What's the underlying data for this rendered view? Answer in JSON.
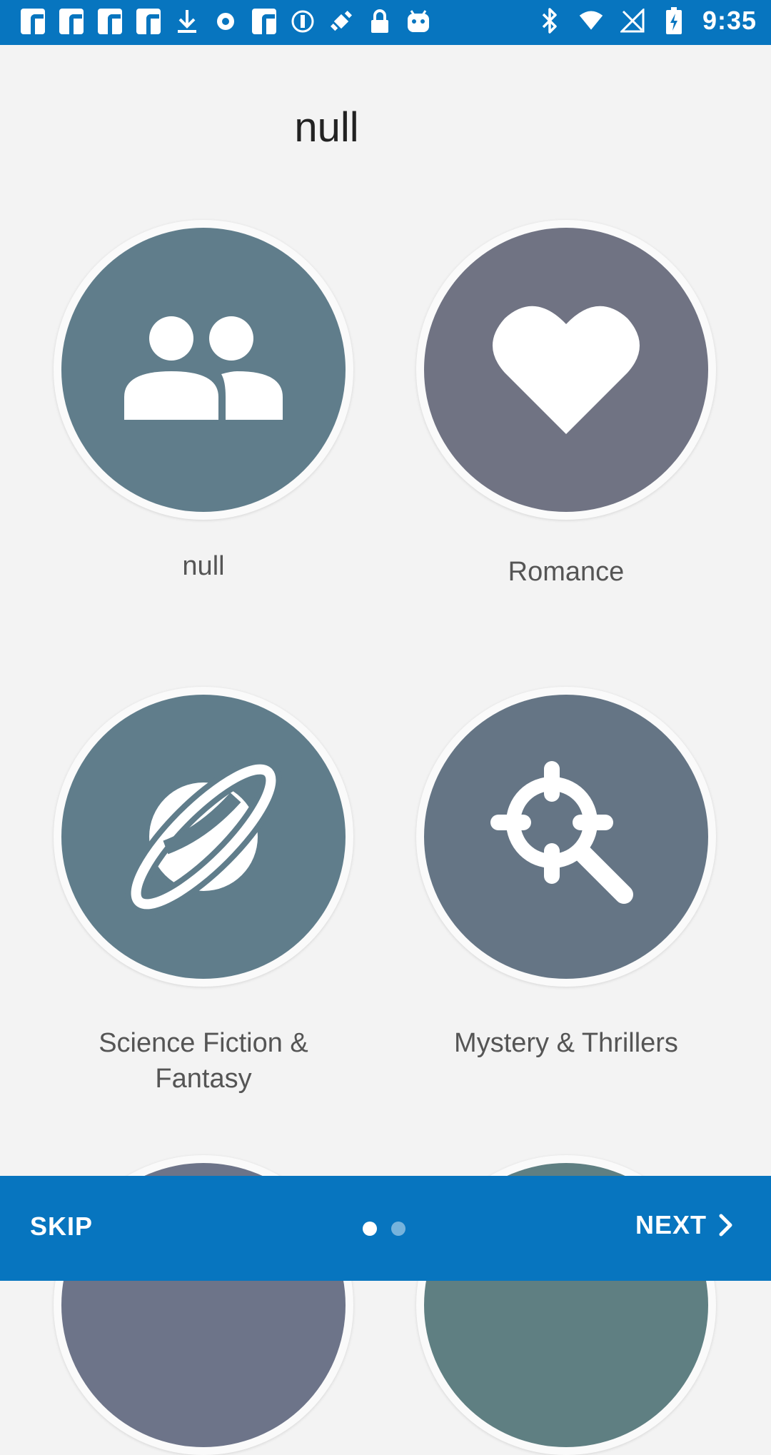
{
  "status_bar": {
    "time": "9:35",
    "left_icons": [
      "facebook-icon",
      "facebook-icon",
      "facebook-icon",
      "facebook-icon",
      "download-icon",
      "record-icon",
      "facebook-icon",
      "info-circle-icon",
      "fake-gps-icon",
      "lock-icon",
      "android-icon"
    ],
    "right_icons": [
      "bluetooth-icon",
      "wifi-icon",
      "no-signal-icon",
      "battery-charging-icon"
    ]
  },
  "page": {
    "title": "null"
  },
  "categories": [
    {
      "label": "null",
      "icon": "group-icon",
      "color": "#607d8b"
    },
    {
      "label": "Romance",
      "icon": "heart-icon",
      "color": "#707383"
    },
    {
      "label": "Science Fiction & Fantasy",
      "icon": "planet-icon",
      "color": "#607d8b"
    },
    {
      "label": "Mystery & Thrillers",
      "icon": "magnifier-crosshair-icon",
      "color": "#657585"
    },
    {
      "label": "",
      "icon": "",
      "color": "#6d7489"
    },
    {
      "label": "",
      "icon": "",
      "color": "#5f7f82"
    }
  ],
  "bottom_bar": {
    "skip_label": "SKIP",
    "next_label": "NEXT",
    "page_count": 2,
    "current_page": 1
  },
  "colors": {
    "accent": "#0775bf",
    "background": "#f3f3f3"
  }
}
